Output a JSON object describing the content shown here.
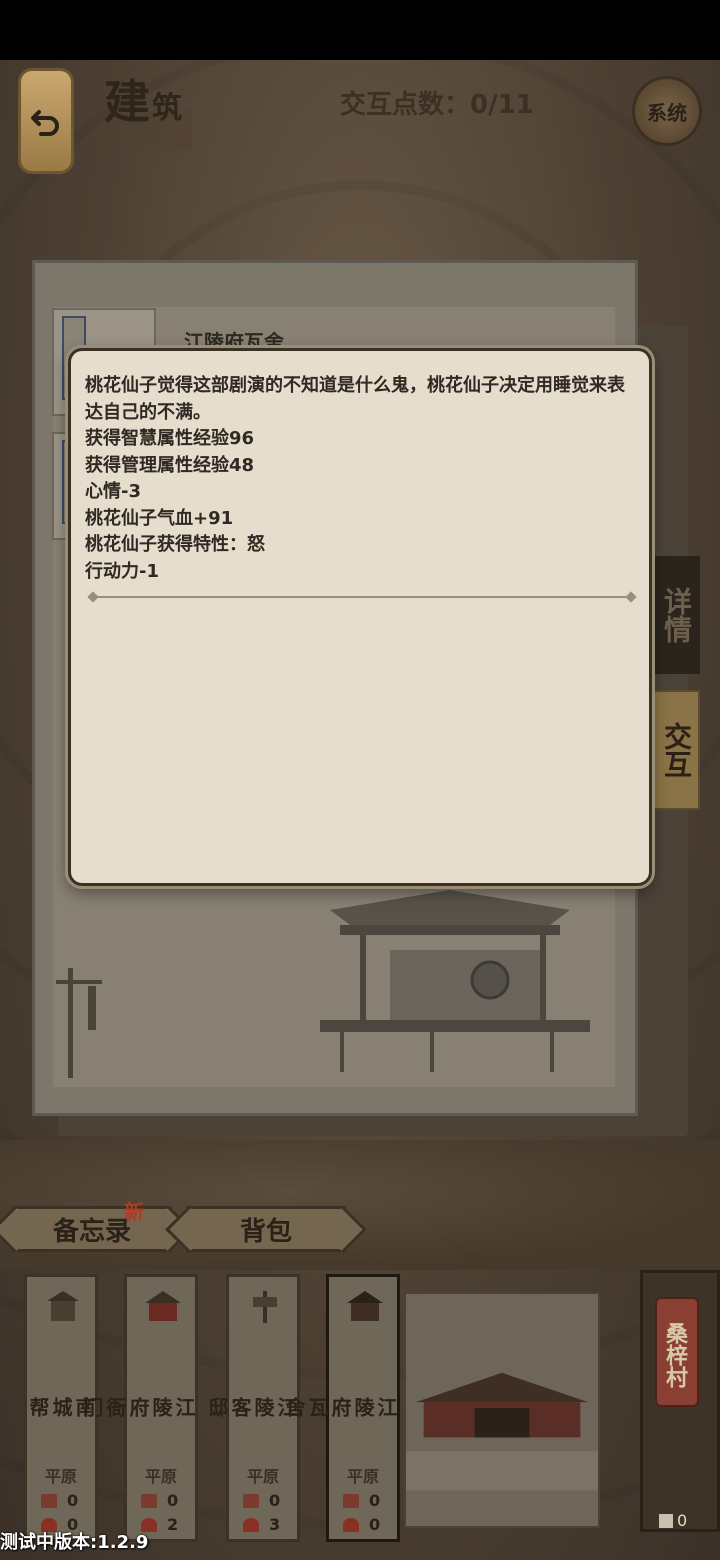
{
  "header": {
    "title_main": "建",
    "title_sub": "筑",
    "points_label": "交互点数：0/11",
    "system_label": "系统"
  },
  "panel": {
    "building_name": "江陵府瓦舍",
    "slot_tag": "交",
    "tabs": {
      "detail": "详情",
      "interact": "交互"
    }
  },
  "modal": {
    "lines": [
      "桃花仙子觉得这部剧演的不知道是什么鬼，桃花仙子决定用睡觉来表达自己的不满。",
      "获得智慧属性经验96",
      "获得管理属性经验48",
      "心情-3",
      "桃花仙子气血+91",
      "桃花仙子获得特性：怒",
      "行动力-1"
    ]
  },
  "bottom": {
    "memo_label": "备忘录",
    "memo_badge": "新",
    "bag_label": "背包",
    "cards": [
      {
        "name": "南城帮",
        "terrain": "平原",
        "flags": "0",
        "people": "0"
      },
      {
        "name": "江陵府衙门",
        "terrain": "平原",
        "flags": "0",
        "people": "2"
      },
      {
        "name": "江陵客邸",
        "terrain": "平原",
        "flags": "0",
        "people": "3"
      },
      {
        "name": "江陵府瓦舍",
        "terrain": "平原",
        "flags": "0",
        "people": "0"
      }
    ],
    "village_name": "桑梓村",
    "village_count": "0"
  },
  "version": "测试中版本:1.2.9",
  "colors": {
    "modal_bg": "#e6ddcd",
    "accent_red": "#b33a24",
    "frame_dark": "#3a3126"
  }
}
